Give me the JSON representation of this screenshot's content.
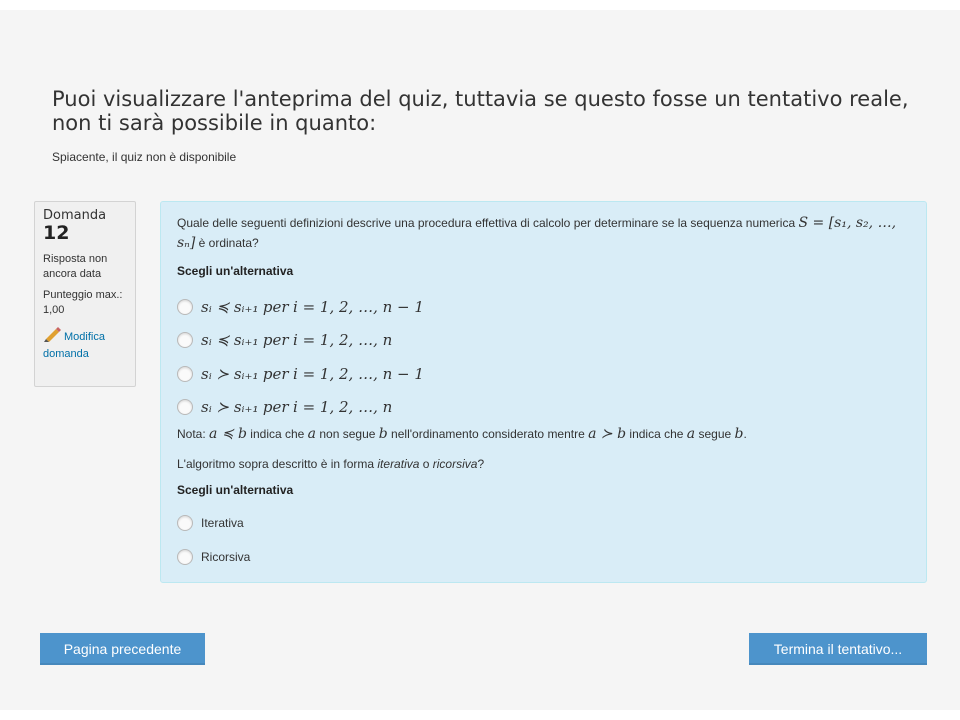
{
  "heading": "Puoi visualizzare l'anteprima del quiz, tuttavia se questo fosse un tentativo reale, non ti sarà possibile in quanto:",
  "notice": "Spiacente, il quiz non è disponibile",
  "info": {
    "question_label": "Domanda",
    "question_number": "12",
    "state": "Risposta non ancora data",
    "grade": "Punteggio max.: 1,00",
    "edit_label": "Modifica domanda",
    "edit_icon": "pencil-icon"
  },
  "question": {
    "text_part1": "Quale delle seguenti definizioni descrive una procedura effettiva di calcolo per determinare se la sequenza numerica ",
    "text_part2": " è ordinata?",
    "sequence_math": "S = [s₁, s₂, …, sₙ]",
    "prompt1": "Scegli un'alternativa",
    "options1": [
      {
        "lhs": "sᵢ ≼ sᵢ₊₁",
        "per": "per",
        "rhs": "i = 1, 2, …, n − 1"
      },
      {
        "lhs": "sᵢ ≼ sᵢ₊₁",
        "per": "per",
        "rhs": "i = 1, 2, …, n"
      },
      {
        "lhs": "sᵢ ≻ sᵢ₊₁",
        "per": "per",
        "rhs": "i = 1, 2, …, n − 1"
      },
      {
        "lhs": "sᵢ ≻ sᵢ₊₁",
        "per": "per",
        "rhs": "i = 1, 2, …, n"
      }
    ],
    "note": {
      "prefix": "Nota: ",
      "m1": "a ≼ b",
      "t1": " indica che ",
      "m2": "a",
      "t2": " non segue ",
      "m3": "b",
      "t3": " nell'ordinamento considerato mentre ",
      "m4": "a ≻ b",
      "t4": " indica che ",
      "m5": "a",
      "t5": " segue ",
      "m6": "b",
      "t6": "."
    },
    "algo": {
      "t1": "L'algoritmo sopra descritto è in forma ",
      "i1": "iterativa",
      "t2": " o ",
      "i2": "ricorsiva",
      "t3": "?"
    },
    "prompt2": "Scegli un'alternativa",
    "options2": [
      "Iterativa",
      "Ricorsiva"
    ]
  },
  "buttons": {
    "prev": "Pagina precedente",
    "finish": "Termina il tentativo..."
  },
  "colors": {
    "page_bg": "#f5f5f5",
    "content_bg": "#d9edf7",
    "info_bg": "#f0f0f0",
    "button_bg": "#4d94cc",
    "link": "#0070a8"
  }
}
